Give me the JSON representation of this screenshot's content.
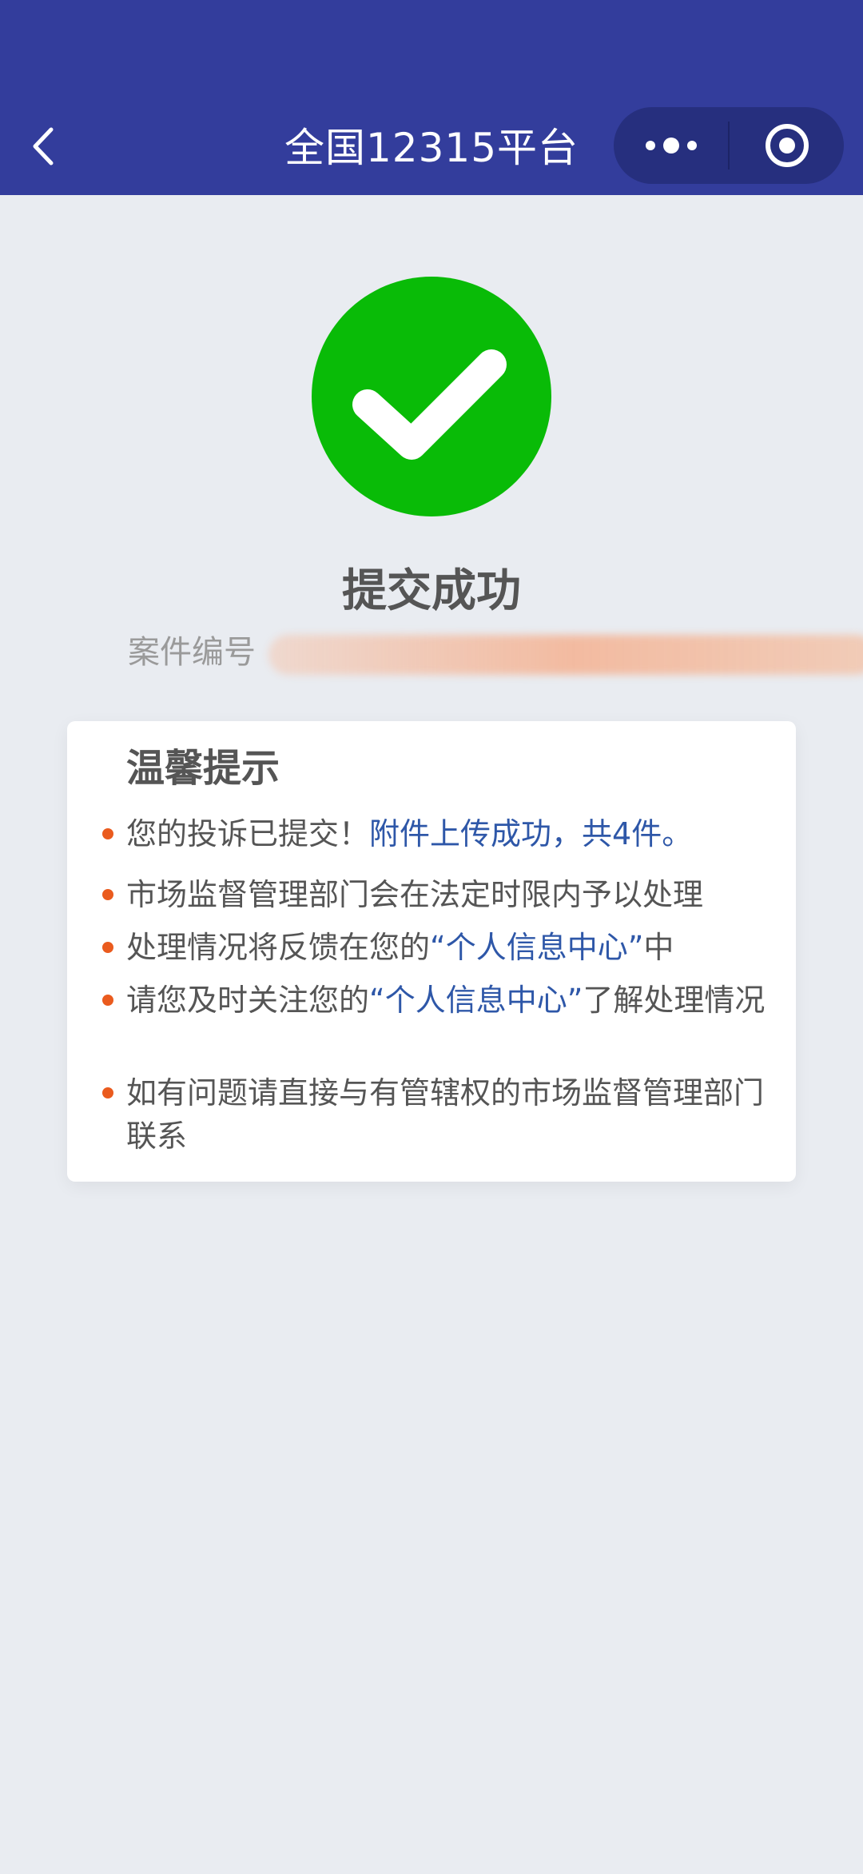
{
  "header": {
    "title": "全国12315平台",
    "icons": {
      "back": "chevron-left-icon",
      "more": "more-dots-icon",
      "close": "target-close-icon"
    },
    "colors": {
      "bar": "#333d9c",
      "capsule": "#262f7e",
      "text": "#ffffff"
    }
  },
  "result": {
    "icon": "check-circle-icon",
    "icon_color": "#09bb07",
    "title": "提交成功",
    "case_label": "案件编号",
    "case_value": "██████████████████"
  },
  "tips": {
    "title": "温馨提示",
    "items": [
      {
        "t1": "您的投诉已提交！",
        "hl": "附件上传成功，共4件。"
      },
      {
        "t1": "市场监督管理部门会在法定时限内予以处理"
      },
      {
        "t1": "处理情况将反馈在您的",
        "hl": "“个人信息中心”",
        "t2": "中"
      },
      {
        "t1": "请您及时关注您的",
        "hl": "“个人信息中心”",
        "t2": "了解处理情况"
      },
      {
        "t1": "如有问题请直接与有管辖权的市场监督管理部门联系"
      }
    ],
    "colors": {
      "bullet": "#ea5b1e",
      "highlight": "#2e57a8",
      "text": "#555555"
    }
  }
}
